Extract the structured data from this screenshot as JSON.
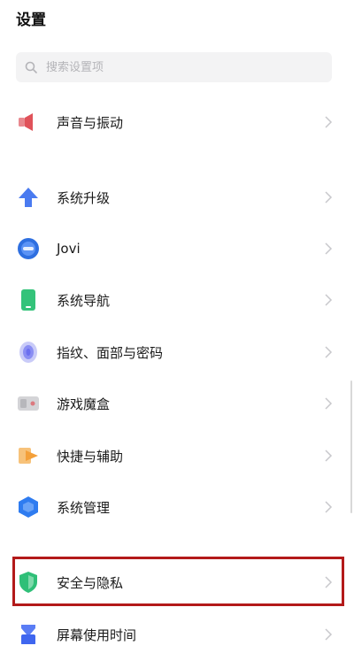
{
  "header": {
    "title": "设置"
  },
  "search": {
    "placeholder": "搜索设置项"
  },
  "items": [
    {
      "label": "声音与振动",
      "icon": "speaker-icon"
    },
    {
      "label": "系统升级",
      "icon": "upgrade-arrow-icon"
    },
    {
      "label": "Jovi",
      "icon": "jovi-icon"
    },
    {
      "label": "系统导航",
      "icon": "phone-navigation-icon"
    },
    {
      "label": "指纹、面部与密码",
      "icon": "fingerprint-icon"
    },
    {
      "label": "游戏魔盒",
      "icon": "game-box-icon"
    },
    {
      "label": "快捷与辅助",
      "icon": "shortcut-icon"
    },
    {
      "label": "系统管理",
      "icon": "system-management-icon"
    },
    {
      "label": "安全与隐私",
      "icon": "security-shield-icon"
    },
    {
      "label": "屏幕使用时间",
      "icon": "screen-time-icon"
    }
  ],
  "colors": {
    "highlight": "#b31a1a",
    "speaker": "#e0525a",
    "upgrade": "#4a7bf0",
    "jovi": "#2e6fe0",
    "navigation": "#34c37a",
    "fingerprint": "#6b6ff0",
    "game": "#c9c9cc",
    "shortcut": "#f4a03a",
    "system": "#2f7cf0",
    "security": "#2fbf78",
    "screen_time": "#5a7df5"
  }
}
